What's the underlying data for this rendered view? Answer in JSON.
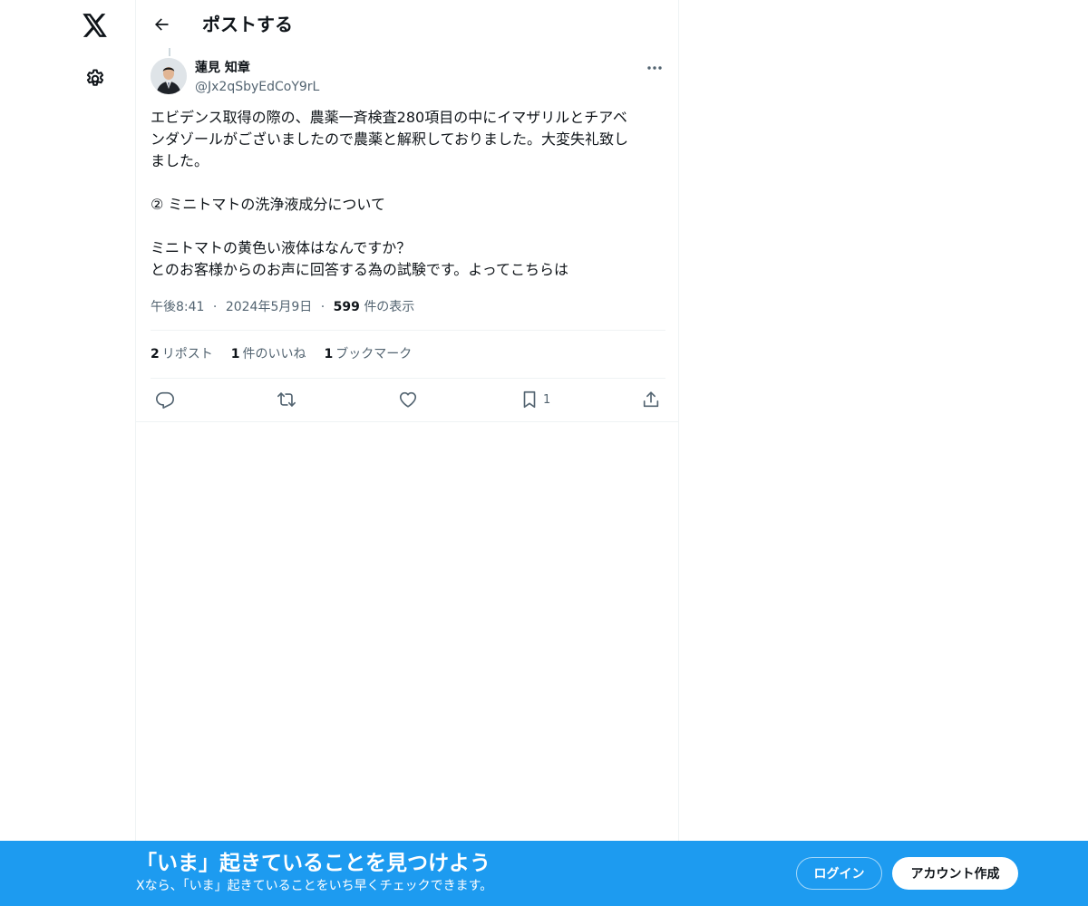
{
  "nav": {
    "logo_icon": "x-logo-icon",
    "settings_icon": "gear-icon"
  },
  "header": {
    "title": "ポストする",
    "back_icon": "arrow-left-icon"
  },
  "post": {
    "author": {
      "name": "蓮見 知章",
      "handle": "@Jx2qSbyEdCoY9rL"
    },
    "text_lines": [
      "エビデンス取得の際の、農薬一斉検査280項目の中にイマザリルとチアベ",
      "ンダゾールがございましたので農薬と解釈しておりました。大変失礼致し",
      "ました。",
      "",
      "② ミニトマトの洗浄液成分について",
      "",
      "ミニトマトの黄色い液体はなんですか？",
      "とのお客様からのお声に回答する為の試験です。よってこちらは"
    ],
    "time": "午後8:41",
    "date": "2024年5月9日",
    "separator": "·",
    "views_count": "599",
    "views_label": "件の表示",
    "stats": {
      "reposts_count": "2",
      "reposts_label": "リポスト",
      "likes_count": "1",
      "likes_label": "件のいいね",
      "bookmarks_count": "1",
      "bookmarks_label": "ブックマーク"
    },
    "actions": {
      "bookmark_count": "1"
    }
  },
  "banner": {
    "title": "「いま」起きていることを見つけよう",
    "subtitle": "Xなら、「いま」起きていることをいち早くチェックできます。",
    "login_label": "ログイン",
    "signup_label": "アカウント作成"
  },
  "colors": {
    "accent": "#1d9bf0",
    "text_primary": "#0f1419",
    "text_secondary": "#536471",
    "border": "#eff3f4"
  }
}
